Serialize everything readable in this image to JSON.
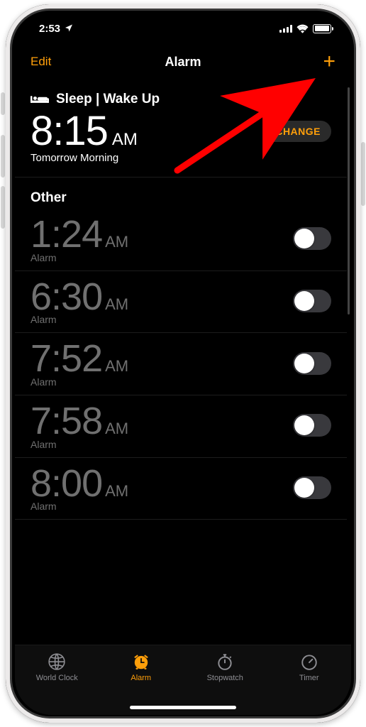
{
  "status": {
    "time": "2:53"
  },
  "nav": {
    "edit": "Edit",
    "title": "Alarm",
    "add": "+"
  },
  "sleep": {
    "section_label": "Sleep | Wake Up",
    "time": "8:15",
    "ampm": "AM",
    "subtitle": "Tomorrow Morning",
    "change": "CHANGE"
  },
  "other": {
    "title": "Other",
    "alarms": [
      {
        "time": "1:24",
        "ampm": "AM",
        "label": "Alarm",
        "on": false
      },
      {
        "time": "6:30",
        "ampm": "AM",
        "label": "Alarm",
        "on": false
      },
      {
        "time": "7:52",
        "ampm": "AM",
        "label": "Alarm",
        "on": false
      },
      {
        "time": "7:58",
        "ampm": "AM",
        "label": "Alarm",
        "on": false
      },
      {
        "time": "8:00",
        "ampm": "AM",
        "label": "Alarm",
        "on": false
      }
    ]
  },
  "tabs": {
    "world_clock": "World Clock",
    "alarm": "Alarm",
    "stopwatch": "Stopwatch",
    "timer": "Timer"
  },
  "colors": {
    "accent": "#ff9f0a",
    "inactive": "#8e8e93",
    "arrow": "#ff0000"
  }
}
